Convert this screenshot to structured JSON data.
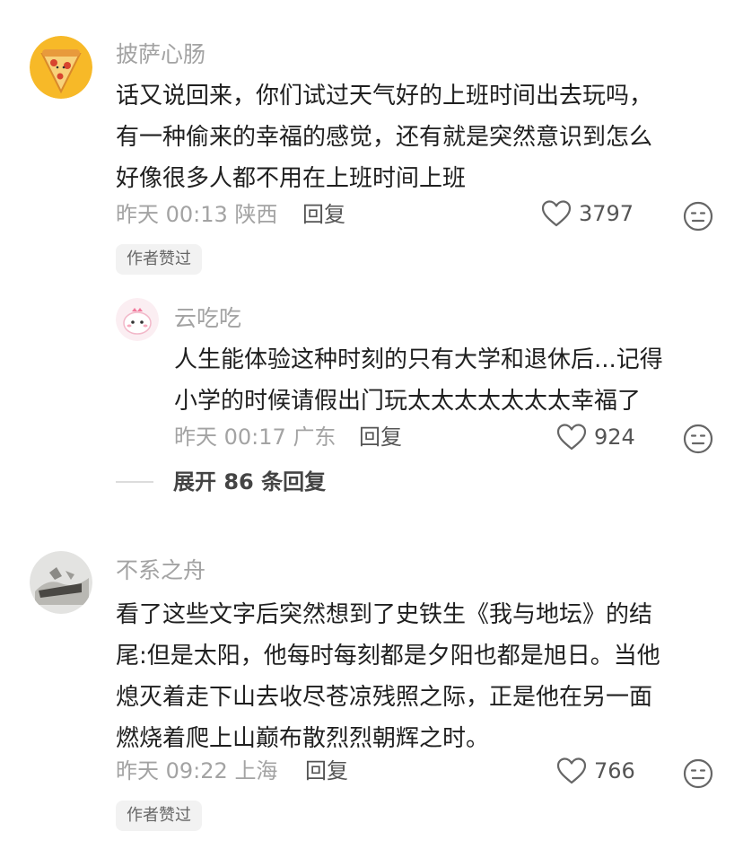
{
  "comments": [
    {
      "username": "披萨心肠",
      "lines": [
        "话又说回来，你们试过天气好的上班时间出去玩吗，",
        "有一种偷来的幸福的感觉，还有就是突然意识到怎么",
        "好像很多人都不用在上班时间上班"
      ],
      "time": "昨天 00:13",
      "location": "陕西",
      "reply_label": "回复",
      "likes": "3797",
      "badge": "作者赞过",
      "replies": [
        {
          "username": "云吃吃",
          "lines": [
            "人生能体验这种时刻的只有大学和退休后...记得",
            "小学的时候请假出门玩太太太太太太太幸福了"
          ],
          "time": "昨天 00:17",
          "location": "广东",
          "reply_label": "回复",
          "likes": "924"
        }
      ],
      "expand_label": "展开 86 条回复"
    },
    {
      "username": "不系之舟",
      "lines": [
        "看了这些文字后突然想到了史铁生《我与地坛》的结",
        "尾:但是太阳，他每时每刻都是夕阳也都是旭日。当他",
        "熄灭着走下山去收尽苍凉残照之际，正是他在另一面",
        "燃烧着爬上山巅布散烈烈朝辉之时。"
      ],
      "time": "昨天 09:22",
      "location": "上海",
      "reply_label": "回复",
      "likes": "766",
      "badge": "作者赞过"
    }
  ],
  "icons": {
    "like": "heart-outline-icon",
    "dislike": "meh-face-icon"
  },
  "colors": {
    "secondary_text": "#a3a3a3",
    "badge_bg": "#f2f2f2",
    "avatar1_bg": "#f7b928"
  }
}
